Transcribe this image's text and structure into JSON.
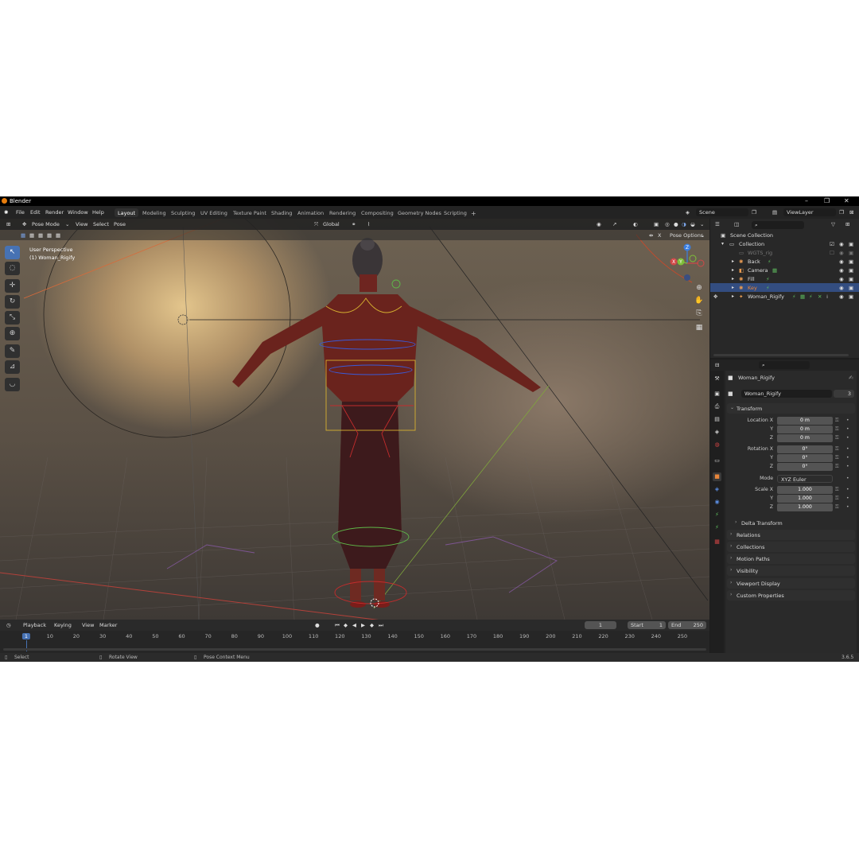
{
  "titlebar": {
    "title": "Blender"
  },
  "menu": {
    "items": [
      "File",
      "Edit",
      "Render",
      "Window",
      "Help"
    ]
  },
  "workspaces": {
    "active": "Layout",
    "tabs": [
      "Layout",
      "Modeling",
      "Sculpting",
      "UV Editing",
      "Texture Paint",
      "Shading",
      "Animation",
      "Rendering",
      "Compositing",
      "Geometry Nodes",
      "Scripting"
    ],
    "add": "+"
  },
  "scene": {
    "label": "Scene",
    "view_layer": "ViewLayer"
  },
  "viewport_header": {
    "mode": "Pose Mode",
    "menus": [
      "View",
      "Select",
      "Pose"
    ],
    "orientation": "Global",
    "pose_options": "Pose Options",
    "x_mirror": "X"
  },
  "viewport": {
    "perspective": "User Perspective",
    "object": "(1) Woman_Rigify",
    "gizmo": {
      "x": "X",
      "y": "Y",
      "z": "Z"
    }
  },
  "outliner": {
    "rows": [
      {
        "label": "Scene Collection"
      },
      {
        "label": "Collection"
      },
      {
        "label": "WGTS_rig"
      },
      {
        "label": "Back"
      },
      {
        "label": "Camera"
      },
      {
        "label": "Fill"
      },
      {
        "label": "Key"
      },
      {
        "label": "Woman_Rigify"
      }
    ]
  },
  "properties": {
    "object_name": "Woman_Rigify",
    "data_name": "Woman_Rigify",
    "users": "3",
    "transform": {
      "title": "Transform",
      "location_label": "Location X",
      "location": [
        "0 m",
        "0 m",
        "0 m"
      ],
      "rotation_label": "Rotation X",
      "rotation": [
        "0°",
        "0°",
        "0°"
      ],
      "mode_label": "Mode",
      "mode": "XYZ Euler",
      "scale_label": "Scale X",
      "scale": [
        "1.000",
        "1.000",
        "1.000"
      ],
      "y": "Y",
      "z": "Z",
      "delta": "Delta Transform"
    },
    "sections": [
      "Relations",
      "Collections",
      "Motion Paths",
      "Visibility",
      "Viewport Display",
      "Custom Properties"
    ]
  },
  "timeline": {
    "menus": [
      "Playback",
      "Keying",
      "View",
      "Marker"
    ],
    "current_frame": "1",
    "start_label": "Start",
    "start": "1",
    "end_label": "End",
    "end": "250",
    "ticks": [
      "1",
      "10",
      "20",
      "30",
      "40",
      "50",
      "60",
      "70",
      "80",
      "90",
      "100",
      "110",
      "120",
      "130",
      "140",
      "150",
      "160",
      "170",
      "180",
      "190",
      "200",
      "210",
      "220",
      "230",
      "240",
      "250"
    ]
  },
  "statusbar": {
    "select": "Select",
    "rotate": "Rotate View",
    "context": "Pose Context Menu",
    "version": "3.6.5"
  },
  "colors": {
    "accent": "#4772b3",
    "selected_row": "#334d80",
    "frame_marker": "#4772b3",
    "blender_orange": "#e87d0d"
  }
}
